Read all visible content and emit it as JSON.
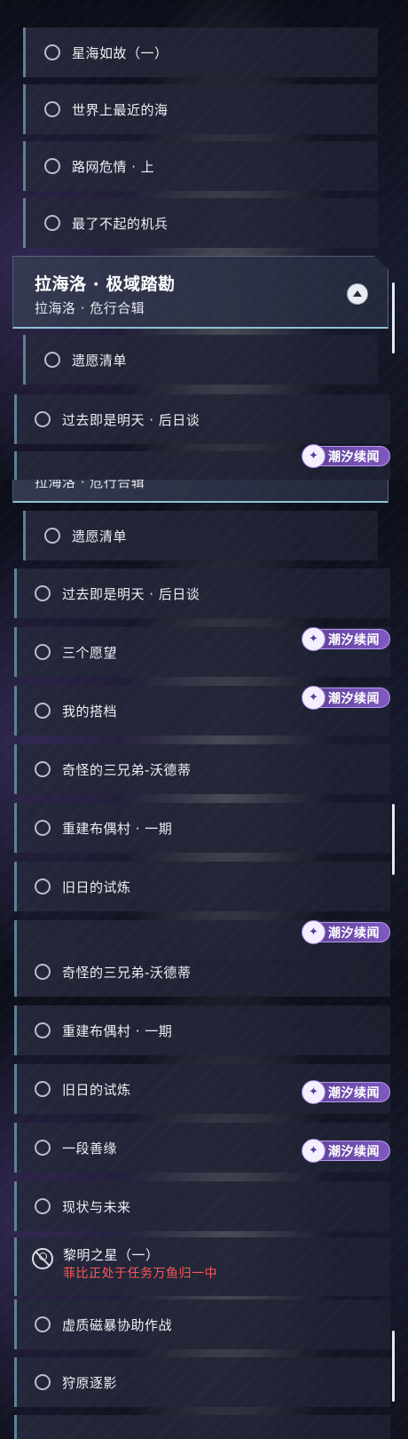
{
  "badge_label": "潮汐续闻",
  "badge_icon": "tidal-gacha-icon",
  "colors": {
    "accent_cyan": "#8fc4d8",
    "badge_purple": "#7a55b8",
    "warning_red": "#ff5555",
    "row_border": "#5e7f98"
  },
  "screen1": {
    "quests": [
      "星海如故（一）",
      "世界上最近的海",
      "路网危情 · 上",
      "最了不起的机兵"
    ],
    "chapter": {
      "title": "拉海洛 · 极域踏勘",
      "subtitle": "拉海洛 · 危行合辑"
    },
    "after_chapter": [
      "遗愿清单",
      "过去即是明天 · 后日谈"
    ]
  },
  "screen2": {
    "chapter_subtitle": "拉海洛 · 危行合辑",
    "quests": [
      "遗愿清单",
      "过去即是明天 · 后日谈",
      "三个愿望",
      "我的搭档",
      "奇怪的三兄弟-沃德蒂",
      "重建布偶村 · 一期",
      "旧日的试炼"
    ]
  },
  "screen3": {
    "quests": [
      "奇怪的三兄弟-沃德蒂",
      "重建布偶村 · 一期",
      "旧日的试炼",
      "一段善缘",
      "现状与未来"
    ],
    "blocked_quest": {
      "title": "黎明之星（一）",
      "warning": "菲比正处于任务万鱼归一中"
    },
    "quests_after": [
      "虚质磁暴协助作战",
      "狩原逐影"
    ]
  }
}
